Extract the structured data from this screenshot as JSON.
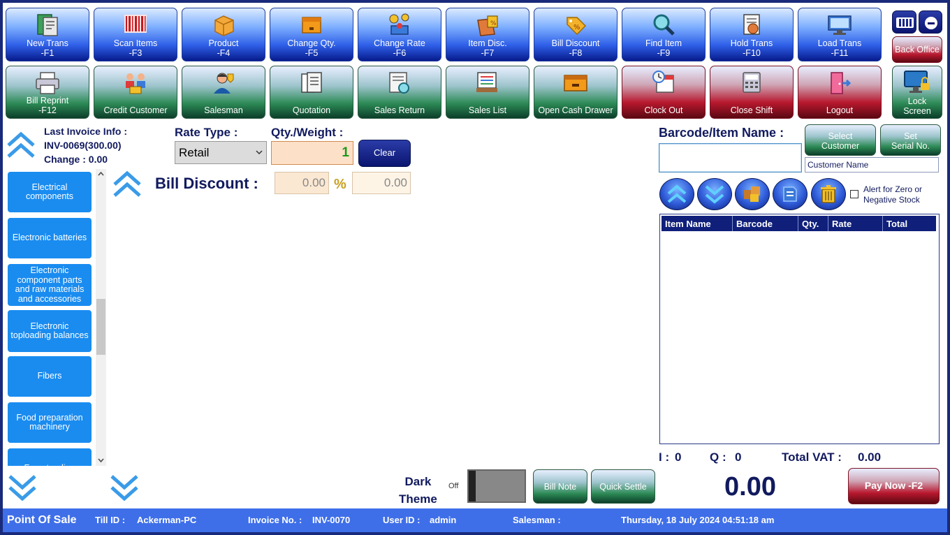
{
  "toolbar_row1": [
    {
      "label": "New Trans\n-F1",
      "icon": "new-trans-icon"
    },
    {
      "label": "Scan Items\n-F3",
      "icon": "barcode-icon"
    },
    {
      "label": "Product\n-F4",
      "icon": "product-box-icon"
    },
    {
      "label": "Change Qty.\n-F5",
      "icon": "change-qty-icon"
    },
    {
      "label": "Change Rate\n-F6",
      "icon": "change-rate-icon"
    },
    {
      "label": "Item Disc.\n-F7",
      "icon": "item-disc-icon"
    },
    {
      "label": "Bill Discount\n-F8",
      "icon": "bill-discount-icon"
    },
    {
      "label": "Find Item\n-F9",
      "icon": "find-item-icon"
    },
    {
      "label": "Hold Trans\n-F10",
      "icon": "hold-trans-icon"
    },
    {
      "label": "Load Trans\n-F11",
      "icon": "load-trans-icon"
    }
  ],
  "toolbar_row2": [
    {
      "label": "Bill Reprint\n-F12",
      "icon": "printer-icon",
      "style": "green"
    },
    {
      "label": "Credit Customer",
      "icon": "credit-customer-icon",
      "style": "green"
    },
    {
      "label": "Salesman",
      "icon": "salesman-icon",
      "style": "green"
    },
    {
      "label": "Quotation",
      "icon": "quotation-icon",
      "style": "green"
    },
    {
      "label": "Sales Return",
      "icon": "sales-return-icon",
      "style": "green"
    },
    {
      "label": "Sales List",
      "icon": "sales-list-icon",
      "style": "green"
    },
    {
      "label": "Open Cash Drawer",
      "icon": "cash-drawer-icon",
      "style": "green"
    },
    {
      "label": "Clock Out",
      "icon": "clock-out-icon",
      "style": "red"
    },
    {
      "label": "Close Shift",
      "icon": "close-shift-icon",
      "style": "red"
    },
    {
      "label": "Logout",
      "icon": "logout-icon",
      "style": "red"
    }
  ],
  "corner": {
    "back_office": "Back Office",
    "lock_screen": "Lock\nScreen"
  },
  "last_invoice": {
    "title": "Last Invoice Info :",
    "invoice": "INV-0069(300.00)",
    "change": "Change : 0.00"
  },
  "rate_type": {
    "label": "Rate Type :",
    "value": "Retail",
    "options": [
      "Retail"
    ]
  },
  "qty": {
    "label": "Qty./Weight :",
    "value": "1"
  },
  "clear_label": "Clear",
  "bill_discount": {
    "label": "Bill Discount :",
    "amount": "0.00",
    "percent_symbol": "%",
    "percent": "0.00"
  },
  "categories": [
    "Electrical components",
    "Electronic batteries",
    "Electronic component parts and raw materials and accessories",
    "Electronic toploading balances",
    "Fibers",
    "Food preparation machinery",
    "Freestanding"
  ],
  "barcode": {
    "label": "Barcode/Item Name :",
    "value": ""
  },
  "select_customer": "Select\nCustomer",
  "set_serial": "Set\nSerial No.",
  "customer_name": "Customer Name",
  "alert_zero_stock": "Alert for Zero or\nNegative Stock",
  "table_headers": [
    "Item Name",
    "Barcode",
    "Qty.",
    "Rate",
    "Total"
  ],
  "summary": {
    "i_label": "I :",
    "i_value": "0",
    "q_label": "Q :",
    "q_value": "0",
    "vat_label": "Total VAT :",
    "vat_value": "0.00"
  },
  "dark_theme": {
    "label": "Dark\nTheme",
    "state": "Off"
  },
  "bill_note": "Bill Note",
  "quick_settle": "Quick Settle",
  "total": "0.00",
  "pay_now": "Pay Now -F2",
  "status_bar": {
    "app": "Point Of Sale",
    "till_label": "Till ID :",
    "till_value": "Ackerman-PC",
    "invoice_label": "Invoice No. :",
    "invoice_value": "INV-0070",
    "user_label": "User ID :",
    "user_value": "admin",
    "salesman_label": "Salesman :",
    "salesman_value": "",
    "datetime": "Thursday, 18 July 2024 04:51:18 am"
  },
  "colors": {
    "accent_blue": "#1a8cf0",
    "navy": "#111a5e",
    "status_bar": "#3f6fe8",
    "pay_now": "#b8182e"
  }
}
